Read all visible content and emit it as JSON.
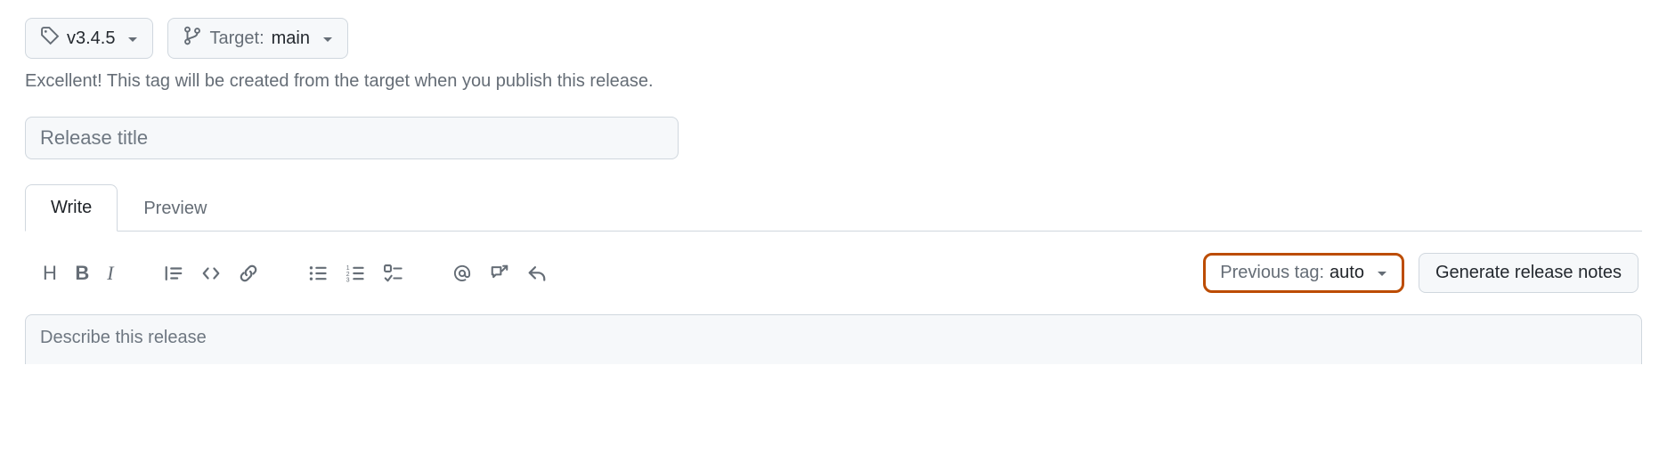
{
  "selectors": {
    "tag_label": "v3.4.5",
    "target_prefix": "Target:",
    "target_value": "main"
  },
  "hint_text": "Excellent! This tag will be created from the target when you publish this release.",
  "title_placeholder": "Release title",
  "tabs": {
    "write": "Write",
    "preview": "Preview"
  },
  "prev_tag": {
    "label": "Previous tag:",
    "value": "auto"
  },
  "generate_label": "Generate release notes",
  "body_placeholder": "Describe this release"
}
